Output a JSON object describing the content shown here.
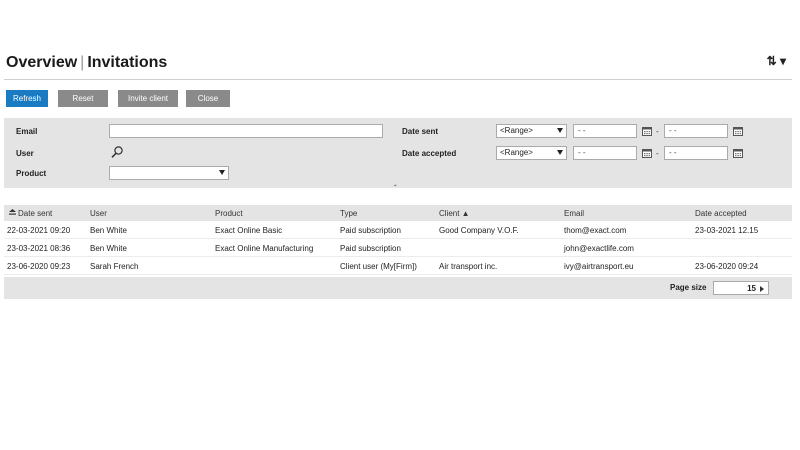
{
  "header": {
    "title_part1": "Overview",
    "title_separator": "|",
    "title_part2": "Invitations",
    "sort_menu_label": "⇅ ▾"
  },
  "toolbar": {
    "refresh_label": "Refresh",
    "reset_label": "Reset",
    "invite_label": "Invite client",
    "close_label": "Close",
    "accent_color": "#1a7ac2"
  },
  "filters": {
    "email_label": "Email",
    "email_value": "",
    "user_label": "User",
    "product_label": "Product",
    "product_value": "",
    "date_sent_label": "Date sent",
    "date_sent_range": "<Range>",
    "date_sent_from": "- -",
    "date_sent_to": "- -",
    "date_accepted_label": "Date accepted",
    "date_accepted_range": "<Range>",
    "date_accepted_from": "- -",
    "date_accepted_to": "- -",
    "range_separator": "-",
    "collapse_glyph": "ˆ"
  },
  "table": {
    "columns": {
      "date_sent": "Date sent",
      "user": "User",
      "product": "Product",
      "type": "Type",
      "client": "Client ▲",
      "email": "Email",
      "date_accepted": "Date accepted"
    },
    "rows": [
      {
        "date_sent": "22-03-2021 09:20",
        "user": "Ben White",
        "product": "Exact Online Basic",
        "type": "Paid subscription",
        "client": "Good Company V.O.F.",
        "email": "thom@exact.com",
        "date_accepted": "23-03-2021 12.15"
      },
      {
        "date_sent": "23-03-2021 08:36",
        "user": "Ben White",
        "product": "Exact Online Manufacturing",
        "type": "Paid subscription",
        "client": "",
        "email": "john@exactlife.com",
        "date_accepted": ""
      },
      {
        "date_sent": "23-06-2020 09:23",
        "user": "Sarah French",
        "product": "",
        "type": "Client user (My[Firm])",
        "client": "Air transport inc.",
        "email": "ivy@airtransport.eu",
        "date_accepted": "23-06-2020 09:24"
      }
    ]
  },
  "footer": {
    "page_size_label": "Page size",
    "page_size_value": "15"
  }
}
